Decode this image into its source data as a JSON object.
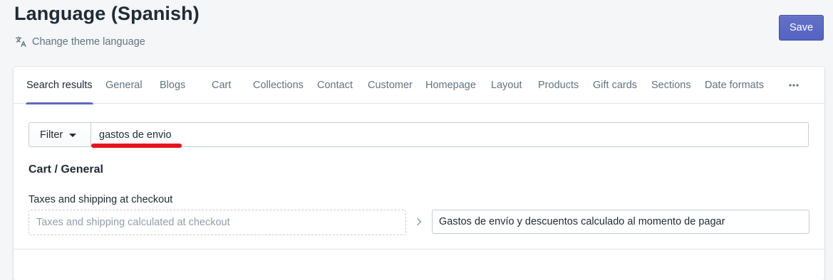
{
  "header": {
    "title": "Language (Spanish)",
    "subaction_label": "Change theme language",
    "save_label": "Save"
  },
  "tabs": [
    {
      "label": "Search results",
      "active": true
    },
    {
      "label": "General"
    },
    {
      "label": "Blogs"
    },
    {
      "label": "Cart"
    },
    {
      "label": "Collections"
    },
    {
      "label": "Contact"
    },
    {
      "label": "Customer"
    },
    {
      "label": "Homepage"
    },
    {
      "label": "Layout"
    },
    {
      "label": "Products"
    },
    {
      "label": "Gift cards"
    },
    {
      "label": "Sections"
    },
    {
      "label": "Date formats"
    }
  ],
  "filter": {
    "label": "Filter",
    "search_value": "gastos de envio"
  },
  "result": {
    "section": "Cart / General",
    "field_label": "Taxes and shipping at checkout",
    "default_text": "Taxes and shipping calculated at checkout",
    "translation_value": "Gastos de envío y descuentos calculado al momento de pagar"
  },
  "colors": {
    "accent": "#5c6ac4",
    "highlight_mark": "#e8141c"
  }
}
